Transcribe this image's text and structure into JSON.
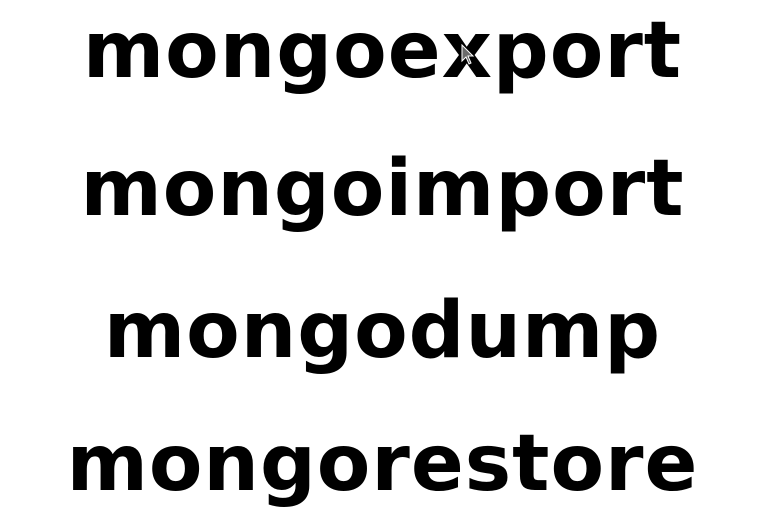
{
  "words": [
    "mongoexport",
    "mongoimport",
    "mongodump",
    "mongorestore"
  ],
  "colors": {
    "background": "#ffffff",
    "text": "#000000",
    "cursor": "#6b6b6b"
  },
  "icons": {
    "cursor": "mouse-pointer-icon"
  }
}
